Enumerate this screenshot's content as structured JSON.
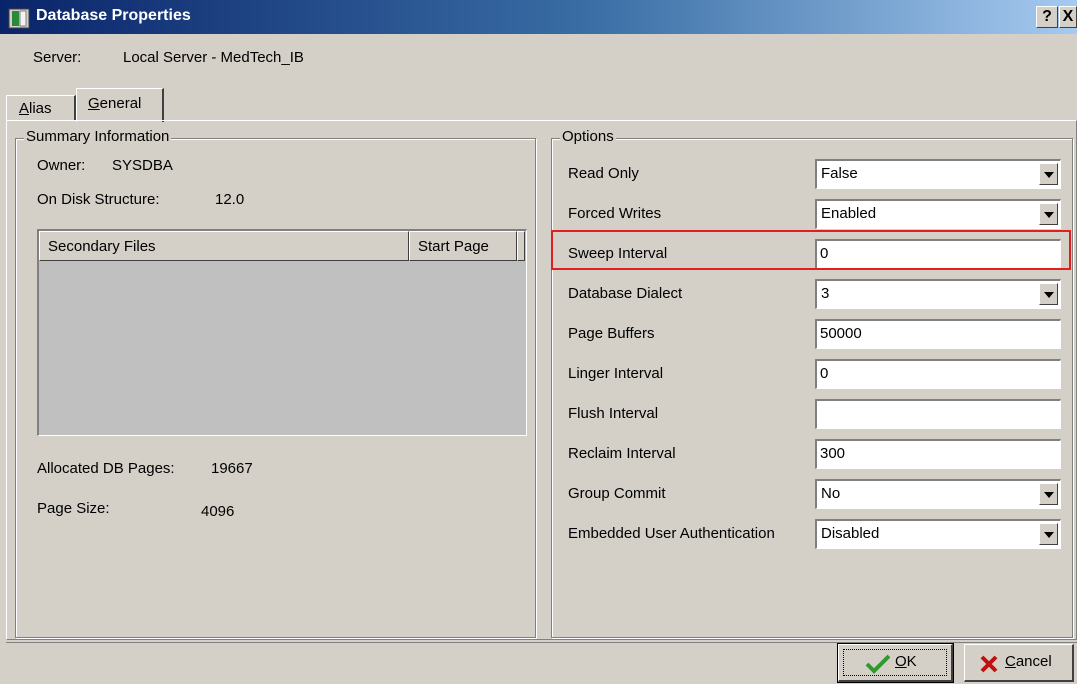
{
  "window": {
    "title": "Database Properties",
    "help_button": "?",
    "close_button": "X"
  },
  "server": {
    "label": "Server:",
    "value": "Local Server - MedTech_IB"
  },
  "tabs": [
    {
      "label": "Alias",
      "selected": false
    },
    {
      "label": "General",
      "selected": true
    }
  ],
  "summary": {
    "title": "Summary Information",
    "owner_label": "Owner:",
    "owner_value": "SYSDBA",
    "ods_label": "On Disk Structure:",
    "ods_value": "12.0",
    "secondary_files": {
      "columns": [
        "Secondary Files",
        "Start Page"
      ],
      "rows": []
    },
    "allocated_label": "Allocated DB Pages:",
    "allocated_value": "19667",
    "page_size_label": "Page Size:",
    "page_size_value": "4096"
  },
  "options": {
    "title": "Options",
    "items": [
      {
        "label": "Read Only",
        "value": "False",
        "type": "combo"
      },
      {
        "label": "Forced Writes",
        "value": "Enabled",
        "type": "combo"
      },
      {
        "label": "Sweep Interval",
        "value": "0",
        "type": "text",
        "highlighted": true
      },
      {
        "label": "Database Dialect",
        "value": "3",
        "type": "combo"
      },
      {
        "label": "Page Buffers",
        "value": "50000",
        "type": "text"
      },
      {
        "label": "Linger Interval",
        "value": "0",
        "type": "text"
      },
      {
        "label": "Flush Interval",
        "value": "",
        "type": "text"
      },
      {
        "label": "Reclaim Interval",
        "value": "300",
        "type": "text"
      },
      {
        "label": "Group Commit",
        "value": "No",
        "type": "combo"
      },
      {
        "label": "Embedded User Authentication",
        "value": "Disabled",
        "type": "combo"
      }
    ]
  },
  "buttons": {
    "ok_label": "OK",
    "cancel_label": "Cancel"
  },
  "colors": {
    "title_bar": "#0a246a",
    "face": "#d4d0c8",
    "highlight_box": "#e02020",
    "ok_check": "#2e9a2e",
    "cancel_x": "#c01010"
  }
}
